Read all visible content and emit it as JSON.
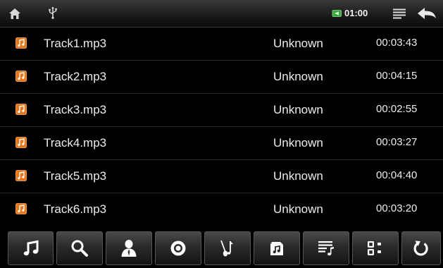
{
  "status_bar": {
    "home_icon": "home-icon",
    "usb_icon": "usb-icon",
    "battery_icon": "battery-icon",
    "clock": "01:00",
    "menu_icon": "list-menu-icon",
    "back_icon": "back-arrow-icon"
  },
  "tracks": [
    {
      "name": "Track1.mp3",
      "artist": "Unknown",
      "duration": "00:03:43"
    },
    {
      "name": "Track2.mp3",
      "artist": "Unknown",
      "duration": "00:04:15"
    },
    {
      "name": "Track3.mp3",
      "artist": "Unknown",
      "duration": "00:02:55"
    },
    {
      "name": "Track4.mp3",
      "artist": "Unknown",
      "duration": "00:03:27"
    },
    {
      "name": "Track5.mp3",
      "artist": "Unknown",
      "duration": "00:04:40"
    },
    {
      "name": "Track6.mp3",
      "artist": "Unknown",
      "duration": "00:03:20"
    }
  ],
  "toolbar": {
    "buttons": [
      "all-songs-icon",
      "search-icon",
      "artist-icon",
      "album-icon",
      "genre-icon",
      "folder-music-icon",
      "playlist-icon",
      "grid-view-icon",
      "refresh-icon"
    ]
  },
  "colors": {
    "background": "#000000",
    "text": "#ececec",
    "track_icon": "#e8771a",
    "battery": "#4ec34e"
  }
}
